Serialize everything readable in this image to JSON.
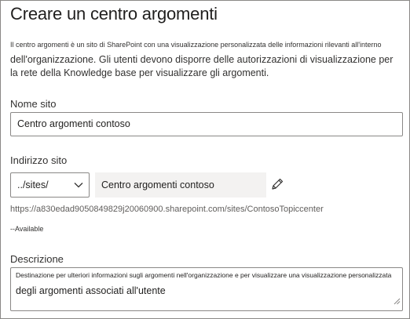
{
  "page": {
    "title": "Creare un centro argomenti",
    "description_line1": "Il centro argomenti è un sito di SharePoint con una visualizzazione personalizzata delle informazioni rilevanti all'interno",
    "description_line2": "dell'organizzazione. Gli utenti devono disporre delle autorizzazioni di visualizzazione per la rete della Knowledge base per visualizzare gli argomenti."
  },
  "site_name": {
    "label": "Nome sito",
    "value": "Centro argomenti contoso"
  },
  "site_address": {
    "label": "Indirizzo sito",
    "path_selected": "../sites/",
    "slug_value": "Centro argomenti contoso",
    "url": "https://a830edad9050849829j20060900.sharepoint.com/sites/ContosoTopiccenter",
    "availability": "--Available"
  },
  "description_field": {
    "label": "Descrizione",
    "value_line1": "Destinazione per ulteriori informazioni sugli argomenti nell'organizzazione e per visualizzare una visualizzazione personalizzata",
    "value_line2": "degli argomenti associati all'utente"
  },
  "icons": {
    "dropdown": "chevron-down-icon",
    "edit": "pencil-icon",
    "resize": "resize-grip-icon"
  },
  "colors": {
    "border": "#8a8886",
    "readonly_bg": "#f3f2f1",
    "text": "#323130"
  }
}
